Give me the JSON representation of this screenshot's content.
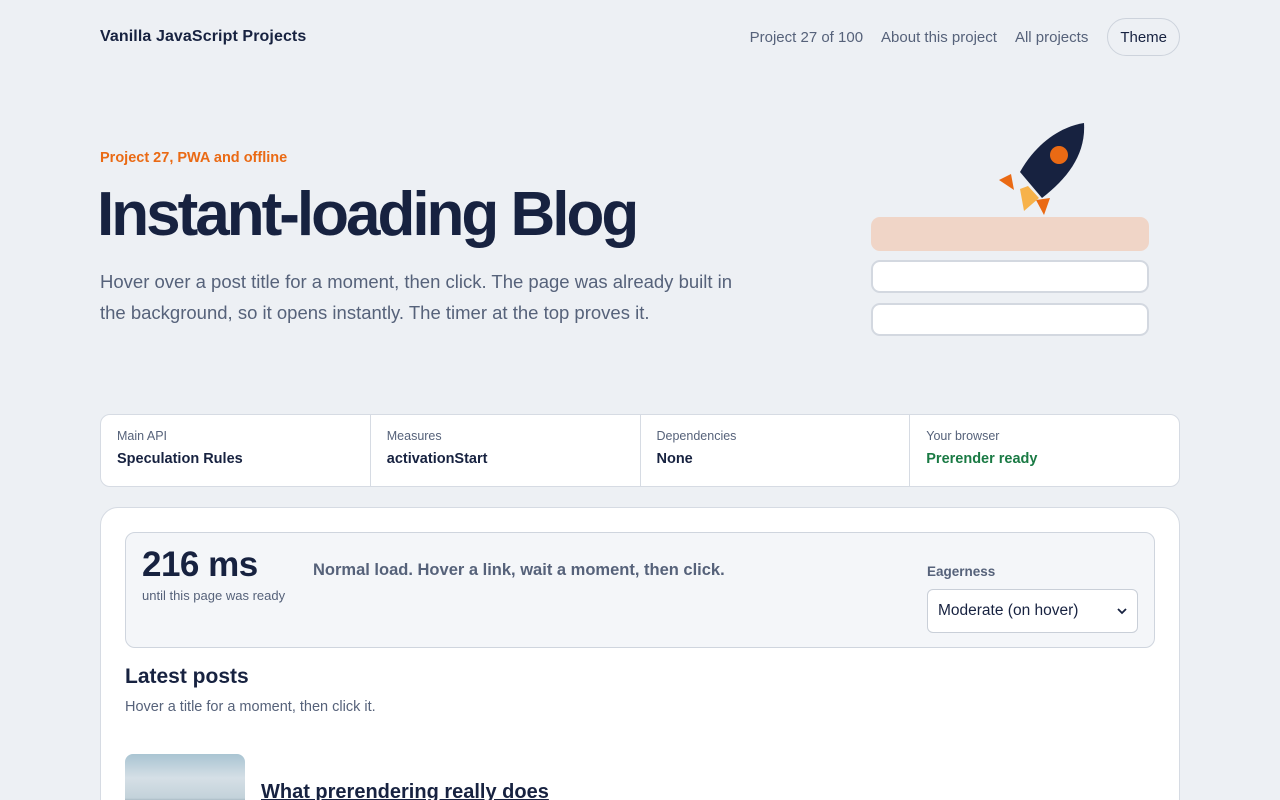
{
  "header": {
    "brand": "Vanilla JavaScript Projects",
    "nav": [
      {
        "label": "Project 27 of 100"
      },
      {
        "label": "About this project"
      },
      {
        "label": "All projects"
      }
    ],
    "theme_label": "Theme"
  },
  "hero": {
    "eyebrow": "Project 27, PWA and offline",
    "title": "Instant-loading Blog",
    "description": "Hover over a post title for a moment, then click. The page was already built in the background, so it opens instantly. The timer at the top proves it."
  },
  "info": [
    {
      "label": "Main API",
      "value": "Speculation Rules"
    },
    {
      "label": "Measures",
      "value": "activationStart"
    },
    {
      "label": "Dependencies",
      "value": "None"
    },
    {
      "label": "Your browser",
      "value": "Prerender ready"
    }
  ],
  "timer": {
    "value": "216 ms",
    "subtitle": "until this page was ready",
    "message": "Normal load. Hover a link, wait a moment, then click."
  },
  "eagerness": {
    "label": "Eagerness",
    "selected": "Moderate (on hover)"
  },
  "posts": {
    "heading": "Latest posts",
    "subtitle": "Hover a title for a moment, then click it.",
    "items": [
      {
        "title": "What prerendering really does"
      }
    ]
  },
  "colors": {
    "accent": "#ea6a14",
    "navy": "#172240",
    "success": "#1a7a44",
    "background": "#edf0f4"
  }
}
